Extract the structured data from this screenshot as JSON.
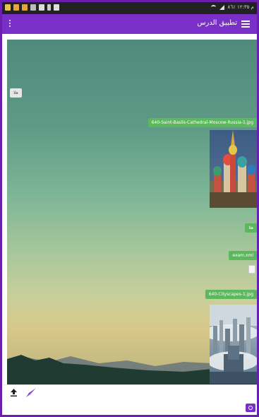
{
  "status_bar": {
    "left_text": "",
    "right_text": "م ١٢:٣٥ ٪٨٦"
  },
  "app_bar": {
    "title": "تطبيق الدرس"
  },
  "chat": {
    "messages": [
      {
        "text": "هلا",
        "side": "left"
      },
      {
        "text": "640-Saint-Basils-Cathedral-Moscow-Russia-1.jpg",
        "side": "right"
      },
      {
        "text": "هلا",
        "side": "right"
      },
      {
        "text": "exam.xml",
        "side": "right"
      },
      {
        "text": "640-Cityscapes-1.jpg",
        "side": "right"
      }
    ]
  },
  "input": {
    "placeholder": ""
  },
  "colors": {
    "accent": "#7b2fc9",
    "bubble": "#5cb85c"
  },
  "icons": [
    "menu-icon",
    "overflow-icon",
    "upload-icon",
    "send-icon",
    "camera-icon"
  ]
}
